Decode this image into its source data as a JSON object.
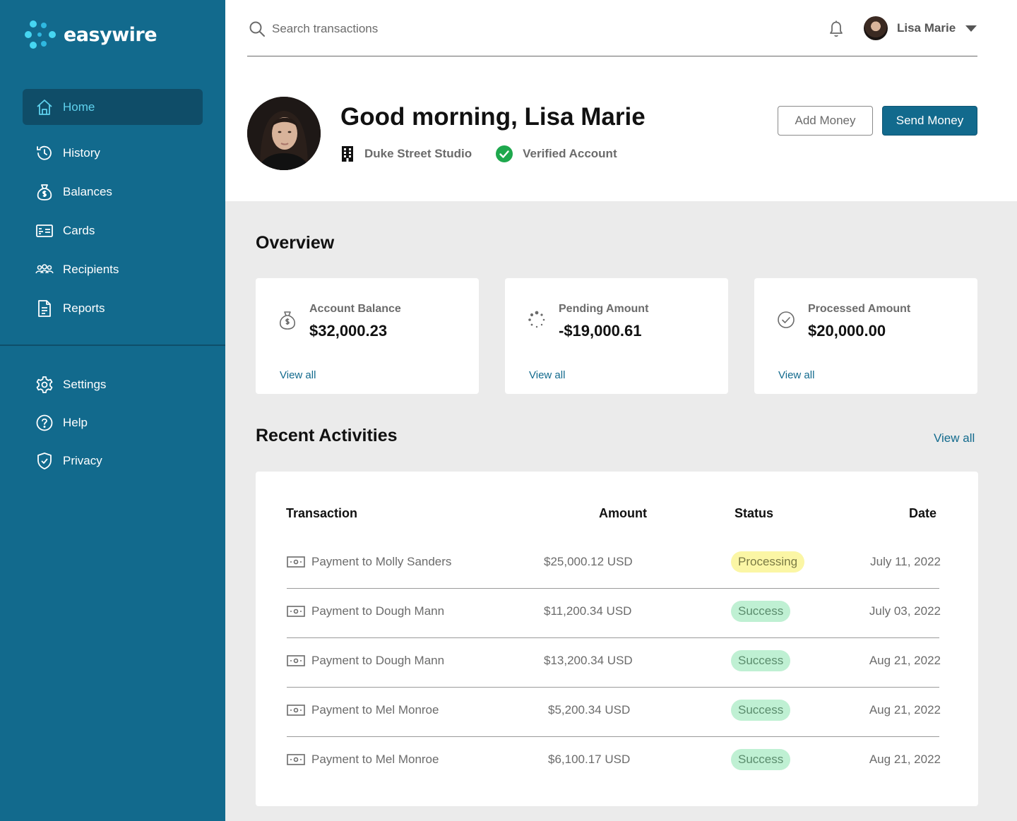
{
  "brand": {
    "name": "easywire"
  },
  "sidebar": {
    "items": [
      {
        "label": "Home",
        "icon": "home-icon",
        "active": true
      },
      {
        "label": "History",
        "icon": "history-icon"
      },
      {
        "label": "Balances",
        "icon": "money-bag-icon"
      },
      {
        "label": "Cards",
        "icon": "card-icon"
      },
      {
        "label": "Recipients",
        "icon": "users-icon"
      },
      {
        "label": "Reports",
        "icon": "document-icon"
      }
    ],
    "secondary": [
      {
        "label": "Settings",
        "icon": "gear-icon"
      },
      {
        "label": "Help",
        "icon": "help-icon"
      },
      {
        "label": "Privacy",
        "icon": "shield-icon"
      }
    ]
  },
  "header": {
    "search_placeholder": "Search transactions",
    "user_name": "Lisa Marie"
  },
  "profile": {
    "greeting": "Good morning, Lisa Marie",
    "company": "Duke Street Studio",
    "verification": "Verified Account",
    "add_money": "Add Money",
    "send_money": "Send Money"
  },
  "overview": {
    "title": "Overview",
    "cards": [
      {
        "label": "Account Balance",
        "value": "$32,000.23",
        "link": "View all",
        "icon": "money-bag-icon"
      },
      {
        "label": "Pending Amount",
        "value": "-$19,000.61",
        "link": "View all",
        "icon": "spinner-icon"
      },
      {
        "label": "Processed Amount",
        "value": "$20,000.00",
        "link": "View all",
        "icon": "check-circle-icon"
      }
    ]
  },
  "activities": {
    "title": "Recent Activities",
    "view_all": "View all",
    "columns": [
      "Transaction",
      "Amount",
      "Status",
      "Date"
    ],
    "rows": [
      {
        "transaction": "Payment to Molly Sanders",
        "amount": "$25,000.12 USD",
        "status": "Processing",
        "date": "July 11, 2022"
      },
      {
        "transaction": "Payment to Dough Mann",
        "amount": "$11,200.34 USD",
        "status": "Success",
        "date": "July 03, 2022"
      },
      {
        "transaction": "Payment to Dough Mann",
        "amount": "$13,200.34 USD",
        "status": "Success",
        "date": "Aug 21, 2022"
      },
      {
        "transaction": "Payment to Mel Monroe",
        "amount": "$5,200.34 USD",
        "status": "Success",
        "date": "Aug 21, 2022"
      },
      {
        "transaction": "Payment to Mel Monroe",
        "amount": "$6,100.17 USD",
        "status": "Success",
        "date": "Aug 21, 2022"
      }
    ]
  },
  "colors": {
    "sidebar": "#126a8d",
    "sidebar_active": "#0f4d68",
    "accent": "#126a8d",
    "logo_accent": "#46d6f2",
    "verified": "#1ea84d",
    "processing_bg": "#fbf6a5",
    "success_bg": "#bff0d3"
  }
}
